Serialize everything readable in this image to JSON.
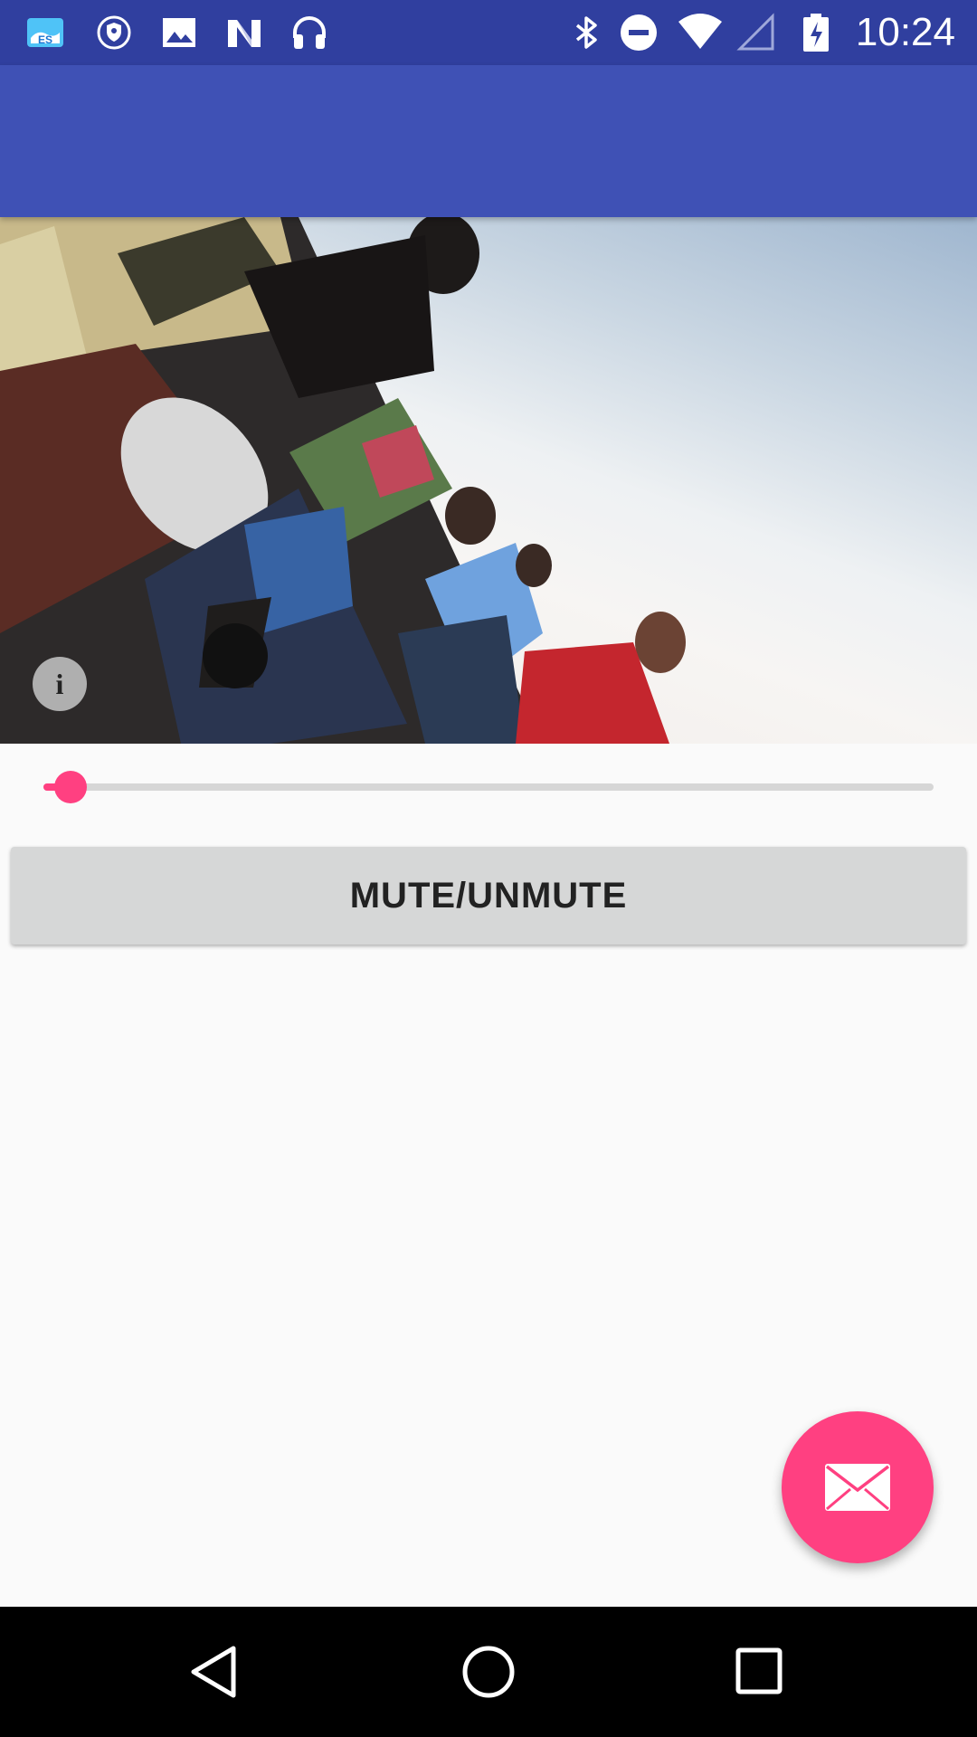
{
  "status_bar": {
    "time": "10:24",
    "left_icons": [
      "es-file-explorer-icon",
      "vpn-shield-icon",
      "image-icon",
      "n-logo-icon",
      "headphones-icon"
    ],
    "right_icons": [
      "bluetooth-icon",
      "do-not-disturb-icon",
      "wifi-icon",
      "cell-signal-icon",
      "battery-charging-icon"
    ]
  },
  "player": {
    "info_glyph": "i",
    "progress": 0.03
  },
  "buttons": {
    "mute_label": "MUTE/UNMUTE"
  },
  "fab": {
    "icon": "email-icon"
  },
  "nav_bar": {
    "icons": [
      "back-icon",
      "home-icon",
      "recents-icon"
    ]
  },
  "colors": {
    "status_bar": "#303F9F",
    "app_bar": "#3F51B5",
    "accent": "#FF4081",
    "background": "#FAFAFA",
    "button": "#D6D7D7"
  }
}
